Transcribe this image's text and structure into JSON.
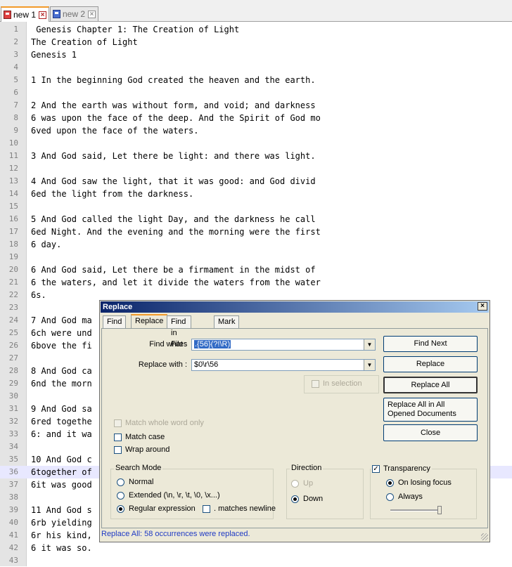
{
  "tabs": [
    {
      "label": "new 1",
      "active": true
    },
    {
      "label": "new 2",
      "active": false
    }
  ],
  "editor": {
    "current_line": 36,
    "lines": [
      {
        "n": "1",
        "t": " Genesis Chapter 1: The Creation of Light"
      },
      {
        "n": "2",
        "t": "The Creation of Light"
      },
      {
        "n": "3",
        "t": "Genesis 1"
      },
      {
        "n": "4",
        "t": ""
      },
      {
        "n": "5",
        "t": "1 In the beginning God created the heaven and the earth."
      },
      {
        "n": "6",
        "t": ""
      },
      {
        "n": "7",
        "t": "2 And the earth was without form, and void; and darkness"
      },
      {
        "n": "8",
        "t": "6 was upon the face of the deep. And the Spirit of God mo"
      },
      {
        "n": "9",
        "t": "6ved upon the face of the waters."
      },
      {
        "n": "10",
        "t": ""
      },
      {
        "n": "11",
        "t": "3 And God said, Let there be light: and there was light."
      },
      {
        "n": "12",
        "t": ""
      },
      {
        "n": "13",
        "t": "4 And God saw the light, that it was good: and God divid"
      },
      {
        "n": "14",
        "t": "6ed the light from the darkness."
      },
      {
        "n": "15",
        "t": ""
      },
      {
        "n": "16",
        "t": "5 And God called the light Day, and the darkness he call"
      },
      {
        "n": "17",
        "t": "6ed Night. And the evening and the morning were the first"
      },
      {
        "n": "18",
        "t": "6 day."
      },
      {
        "n": "19",
        "t": ""
      },
      {
        "n": "20",
        "t": "6 And God said, Let there be a firmament in the midst of"
      },
      {
        "n": "21",
        "t": "6 the waters, and let it divide the waters from the water"
      },
      {
        "n": "22",
        "t": "6s."
      },
      {
        "n": "23",
        "t": ""
      },
      {
        "n": "24",
        "t": "7 And God ma"
      },
      {
        "n": "25",
        "t": "6ch were und"
      },
      {
        "n": "26",
        "t": "6bove the fi"
      },
      {
        "n": "27",
        "t": ""
      },
      {
        "n": "28",
        "t": "8 And God ca"
      },
      {
        "n": "29",
        "t": "6nd the morn"
      },
      {
        "n": "30",
        "t": ""
      },
      {
        "n": "31",
        "t": "9 And God sa"
      },
      {
        "n": "32",
        "t": "6red togethe"
      },
      {
        "n": "33",
        "t": "6: and it wa"
      },
      {
        "n": "34",
        "t": ""
      },
      {
        "n": "35",
        "t": "10 And God c"
      },
      {
        "n": "36",
        "t": "6together of"
      },
      {
        "n": "37",
        "t": "6it was good"
      },
      {
        "n": "38",
        "t": ""
      },
      {
        "n": "39",
        "t": "11 And God s"
      },
      {
        "n": "40",
        "t": "6rb yielding"
      },
      {
        "n": "41",
        "t": "6r his kind,"
      },
      {
        "n": "42",
        "t": "6 it was so."
      },
      {
        "n": "43",
        "t": ""
      }
    ]
  },
  "dialog": {
    "title": "Replace",
    "close_glyph": "×",
    "tabs": [
      "Find",
      "Replace",
      "Find in Files",
      "Mark"
    ],
    "find_label": "Find what :",
    "find_value": ".{56}(?!\\R)",
    "replace_label": "Replace with :",
    "replace_value": "$0\\r\\56",
    "buttons": {
      "find_next": "Find Next",
      "replace": "Replace",
      "replace_all": "Replace All",
      "replace_all_opened": "Replace All in All Opened Documents",
      "close": "Close"
    },
    "in_selection": "In selection",
    "match_whole_word": "Match whole word only",
    "match_case": "Match case",
    "wrap_around": "Wrap around",
    "search_mode": {
      "title": "Search Mode",
      "normal": "Normal",
      "extended": "Extended (\\n, \\r, \\t, \\0, \\x...)",
      "regex": "Regular expression",
      "dot_newline": ". matches newline"
    },
    "direction": {
      "title": "Direction",
      "up": "Up",
      "down": "Down"
    },
    "transparency": {
      "title": "Transparency",
      "on_losing_focus": "On losing focus",
      "always": "Always"
    },
    "status": "Replace All: 58 occurrences were replaced."
  }
}
